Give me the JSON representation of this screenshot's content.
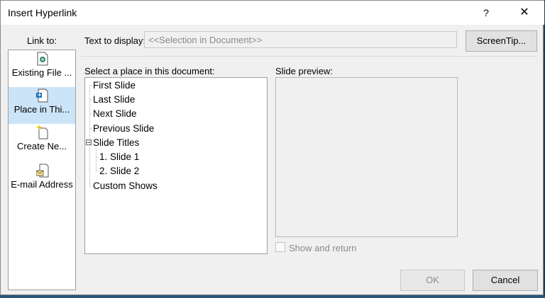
{
  "window": {
    "title": "Insert Hyperlink",
    "help": "?",
    "close": "✕"
  },
  "link_to": {
    "label": "Link to:",
    "items": [
      {
        "label": "Existing File ...",
        "icon": "existing-file-icon",
        "selected": false
      },
      {
        "label": "Place in Thi...",
        "icon": "place-in-document-icon",
        "selected": true
      },
      {
        "label": "Create Ne...",
        "icon": "create-new-document-icon",
        "selected": false
      },
      {
        "label": "E-mail Address",
        "icon": "email-address-icon",
        "selected": false
      }
    ]
  },
  "text_to_display": {
    "label": "Text to display:",
    "value": "<<Selection in Document>>"
  },
  "screentip_button": "ScreenTip...",
  "place_list": {
    "label": "Select a place in this document:",
    "items": [
      {
        "label": "First Slide"
      },
      {
        "label": "Last Slide"
      },
      {
        "label": "Next Slide"
      },
      {
        "label": "Previous Slide"
      },
      {
        "label": "Slide Titles",
        "expander": "⊟"
      },
      {
        "label": "1. Slide 1"
      },
      {
        "label": "2. Slide 2"
      },
      {
        "label": "Custom Shows"
      }
    ]
  },
  "preview": {
    "label": "Slide preview:"
  },
  "show_and_return": {
    "label": "Show and return",
    "checked": false
  },
  "buttons": {
    "ok": "OK",
    "cancel": "Cancel"
  },
  "colors": {
    "selected_bg": "#cce4f7",
    "dialog_bg": "#f0f0f0"
  }
}
